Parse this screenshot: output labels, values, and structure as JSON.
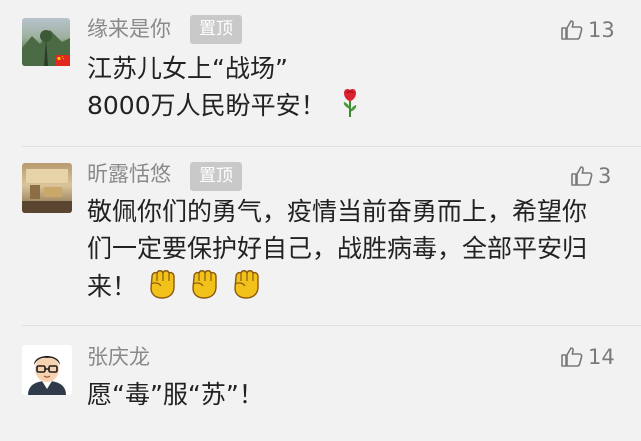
{
  "comments": [
    {
      "username": "缘来是你",
      "pin_label": "置顶",
      "likes": "13",
      "lines": [
        "江苏儿女上“战场”",
        "8000万人民盼平安！"
      ],
      "avatar_icon": "landscape-avatar",
      "flag_icon": "china-flag-icon",
      "emoji_icon": "rose-icon"
    },
    {
      "username": "昕露恬悠",
      "pin_label": "置顶",
      "likes": "3",
      "lines": [
        "敬佩你们的勇气，疫情当前奋勇而上，希望你",
        "们一定要保护好自己，战胜病毒，全部平安归",
        "来！"
      ],
      "avatar_icon": "room-photo-avatar",
      "emoji_icon": "raised-fist-icon"
    },
    {
      "username": "张庆龙",
      "likes": "14",
      "lines": [
        "愿“毒”服“苏”！"
      ],
      "avatar_icon": "cartoon-man-avatar"
    }
  ],
  "colors": {
    "background": "#f2f2f2",
    "username": "#8a8a8a",
    "text": "#222222",
    "badge": "#c9c9c9",
    "fist": "#f2c21b"
  }
}
